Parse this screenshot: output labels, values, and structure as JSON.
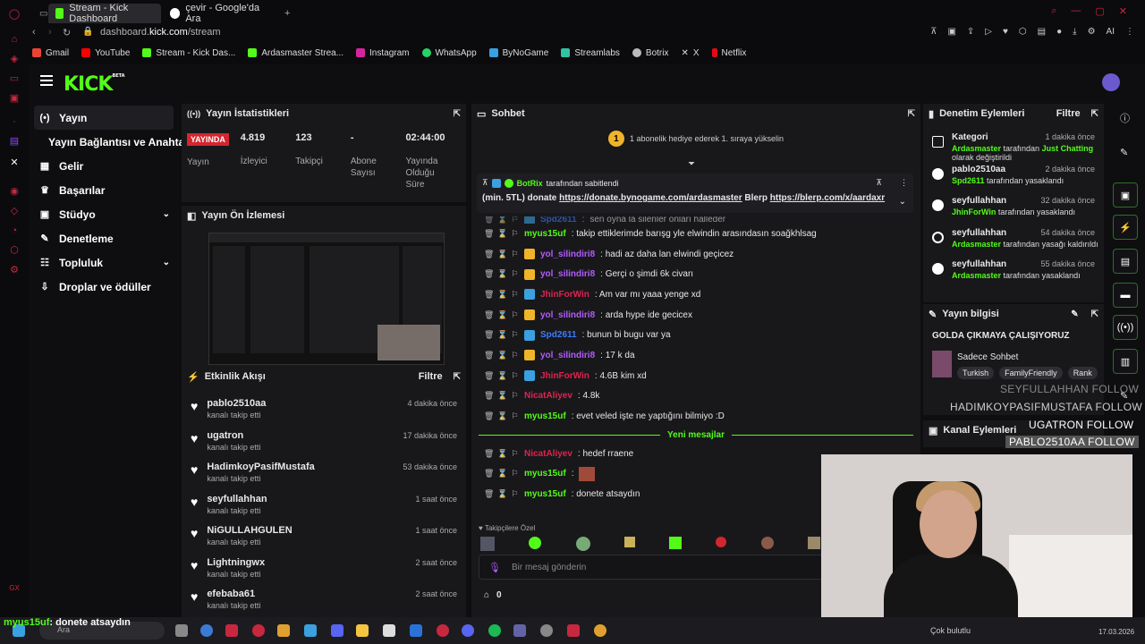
{
  "browser": {
    "tabs": [
      {
        "title": "Stream - Kick Dashboard",
        "active": true
      },
      {
        "title": "çevir - Google'da Ara",
        "active": false
      }
    ],
    "url_host": "dashboard.",
    "url_domain": "kick.com",
    "url_path": "/stream",
    "bookmarks": [
      "Gmail",
      "YouTube",
      "Stream - Kick Das...",
      "Ardasmaster Strea...",
      "Instagram",
      "WhatsApp",
      "ByNoGame",
      "Streamlabs",
      "Botrix",
      "X",
      "Netflix"
    ],
    "ai_label": "AI"
  },
  "app": {
    "logo": "KICK",
    "logo_beta": "BETA",
    "nav": [
      {
        "label": "Yayın",
        "icon": "(•)",
        "active": true,
        "chevron": false
      },
      {
        "label": "Yayın Bağlantısı ve Anahtarı",
        "icon": "",
        "active": false,
        "chevron": false
      },
      {
        "label": "Gelir",
        "icon": "▦",
        "active": false,
        "chevron": false
      },
      {
        "label": "Başarılar",
        "icon": "🏆",
        "active": false,
        "chevron": false
      },
      {
        "label": "Stüdyo",
        "icon": "▣",
        "active": false,
        "chevron": true
      },
      {
        "label": "Denetleme",
        "icon": "🔧",
        "active": false,
        "chevron": false
      },
      {
        "label": "Topluluk",
        "icon": "👥",
        "active": false,
        "chevron": true
      },
      {
        "label": "Droplar ve ödüller",
        "icon": "⬇",
        "active": false,
        "chevron": false
      }
    ]
  },
  "stats_panel": {
    "title": "Yayın İstatistikleri",
    "live_badge": "YAYINDA",
    "live_label": "Yayın",
    "viewers": "4.819",
    "viewers_label": "İzleyici",
    "followers": "123",
    "followers_label": "Takipçi",
    "subs": "-",
    "subs_label_1": "Abone",
    "subs_label_2": "Sayısı",
    "duration": "02:44:00",
    "duration_label_1": "Yayında",
    "duration_label_2": "Olduğu",
    "duration_label_3": "Süre"
  },
  "preview_panel": {
    "title": "Yayın Ön İzlemesi"
  },
  "activity_panel": {
    "title": "Etkinlik Akışı",
    "filter": "Filtre",
    "items": [
      {
        "name": "pablo2510aa",
        "sub": "kanalı takip etti",
        "time": "4 dakika önce"
      },
      {
        "name": "ugatron",
        "sub": "kanalı takip etti",
        "time": "17 dakika önce"
      },
      {
        "name": "HadimkoyPasifMustafa",
        "sub": "kanalı takip etti",
        "time": "53 dakika önce"
      },
      {
        "name": "seyfullahhan",
        "sub": "kanalı takip etti",
        "time": "1 saat önce"
      },
      {
        "name": "NiGULLAHGULEN",
        "sub": "kanalı takip etti",
        "time": "1 saat önce"
      },
      {
        "name": "Lightningwx",
        "sub": "kanalı takip etti",
        "time": "2 saat önce"
      },
      {
        "name": "efebaba61",
        "sub": "kanalı takip etti",
        "time": "2 saat önce"
      }
    ]
  },
  "chat_panel": {
    "title": "Sohbet",
    "sub_banner": "1 abonelik hediye ederek 1. sıraya yükselin",
    "sub_rank": "1",
    "pinned_user": "BotRix",
    "pinned_by": "tarafından sabitlendi",
    "pinned_prefix": "(min. 5TL) donate",
    "pinned_link1": "https://donate.bynogame.com/ardasmaster",
    "pinned_mid": "Blerp",
    "pinned_link2": "https://blerp.com/x/aardaxr",
    "partial_line": "sen oyna la silenler onları halleder",
    "partial_user": "Spd2611",
    "messages": [
      {
        "user": "myus15uf",
        "color": "#53fc18",
        "text": ": takip ettiklerimde barışg yle elwindin arasındasın soağkhlsag",
        "badge": ""
      },
      {
        "user": "yol_silindiri8",
        "color": "#b25bff",
        "text": ": hadi az daha lan elwindi geçicez",
        "badge": "#f0b429"
      },
      {
        "user": "yol_silindiri8",
        "color": "#b25bff",
        "text": ": Gerçi o şimdi 6k civarı",
        "badge": "#f0b429"
      },
      {
        "user": "JhinForWin",
        "color": "#e0234f",
        "text": ": Am var mı yaaa yenge xd",
        "badge": "#3aa0e0"
      },
      {
        "user": "yol_silindiri8",
        "color": "#b25bff",
        "text": ": arda hype ide gecicex",
        "badge": "#f0b429"
      },
      {
        "user": "Spd2611",
        "color": "#3d7bff",
        "text": ": bunun bi bugu var ya",
        "badge": "#3aa0e0"
      },
      {
        "user": "yol_silindiri8",
        "color": "#b25bff",
        "text": ": 17 k da",
        "badge": "#f0b429"
      },
      {
        "user": "JhinForWin",
        "color": "#e0234f",
        "text": ": 4.6B kim xd",
        "badge": "#3aa0e0"
      },
      {
        "user": "NicatAliyev",
        "color": "#e0234f",
        "text": ": 4.8k",
        "badge": ""
      },
      {
        "user": "myus15uf",
        "color": "#53fc18",
        "text": ": evet veled işte ne yaptığını bilmiyo :D",
        "badge": ""
      }
    ],
    "new_messages_label": "Yeni mesajlar",
    "new_messages": [
      {
        "user": "NicatAliyev",
        "color": "#e0234f",
        "text": ": hedef rraene"
      },
      {
        "user": "myus15uf",
        "color": "#53fc18",
        "text": ":"
      },
      {
        "user": "myus15uf",
        "color": "#53fc18",
        "text": ": donete atsaydın"
      }
    ],
    "emote_label": "Takipçilere Özel",
    "input_placeholder": "Bir mesaj gönderin",
    "kick_count": "0"
  },
  "mod_panel": {
    "title": "Denetim Eylemleri",
    "filter": "Filtre",
    "items": [
      {
        "name": "Kategori",
        "by": "Ardasmaster",
        "text": " tarafından ",
        "target": "Just Chatting",
        "text2": " olarak değiştirildi",
        "time": "1 dakika önce"
      },
      {
        "name": "pablo2510aa",
        "by": "Spd2611",
        "text": " tarafından yasaklandı",
        "target": "",
        "text2": "",
        "time": "2 dakika önce"
      },
      {
        "name": "seyfullahhan",
        "by": "JhinForWin",
        "text": " tarafından yasaklandı",
        "target": "",
        "text2": "",
        "time": "32 dakika önce"
      },
      {
        "name": "seyfullahhan",
        "by": "Ardasmaster",
        "text": " tarafından yasağı kaldırıldı",
        "target": "",
        "text2": "",
        "time": "54 dakika önce"
      },
      {
        "name": "seyfullahhan",
        "by": "Ardasmaster",
        "text": " tarafından yasaklandı",
        "target": "",
        "text2": "",
        "time": "55 dakika önce"
      }
    ]
  },
  "info_panel": {
    "title": "Yayın bilgisi",
    "stream_title": "GOLDA ÇIKMAYA ÇALIŞIYORUZ",
    "category": "Sadece Sohbet",
    "tags": [
      "Turkish",
      "FamilyFriendly",
      "Rank"
    ]
  },
  "channel_panel": {
    "title": "Kanal Eylemleri"
  },
  "overlay": {
    "follows": [
      "SEYFULLAHHAN  FOLLOW",
      "HADIMKOYPASIFMUSTAFA  FOLLOW",
      "UGATRON  FOLLOW",
      "PABLO2510AA  FOLLOW"
    ],
    "ticker_user": "myus15uf",
    "ticker_text": ": donete atsaydın"
  },
  "taskbar": {
    "search": "Ara",
    "weather": "Çok bulutlu",
    "date": "17.03.2026"
  }
}
